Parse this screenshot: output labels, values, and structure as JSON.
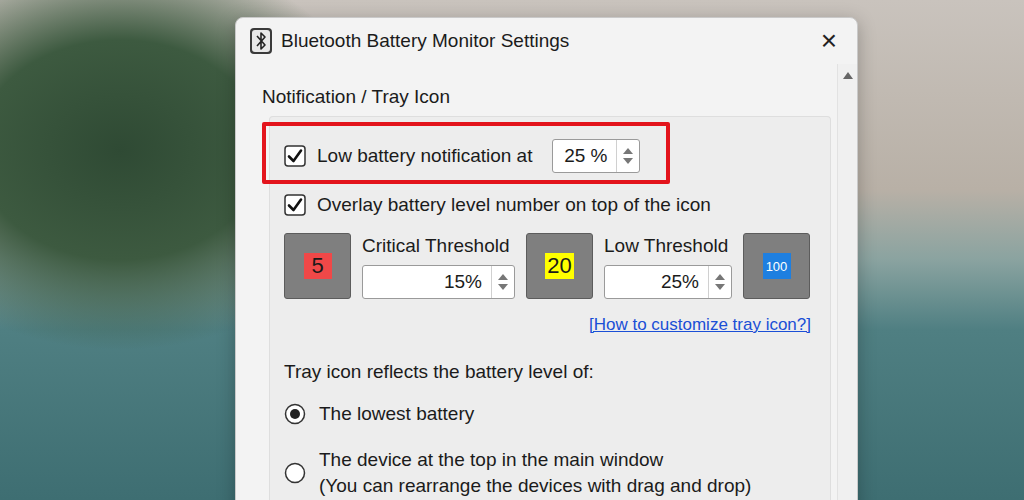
{
  "window": {
    "title": "Bluetooth Battery Monitor Settings",
    "close": "×"
  },
  "section": {
    "title": "Notification / Tray Icon"
  },
  "low_battery": {
    "label": "Low battery notification at",
    "checked": true,
    "value": "25 %"
  },
  "overlay": {
    "label": "Overlay battery level number on top of the icon",
    "checked": true
  },
  "thresholds": {
    "icons": [
      {
        "text": "5",
        "color": "#f04848"
      },
      {
        "text": "20",
        "color": "#ffff00"
      },
      {
        "text": "100",
        "color": "#1e7fe0"
      }
    ],
    "fields": [
      {
        "label": "Critical Threshold",
        "value": "15%"
      },
      {
        "label": "Low Threshold",
        "value": "25%"
      }
    ]
  },
  "link": "[How to customize tray icon?]",
  "tray": {
    "label": "Tray icon reflects the battery level of:",
    "options": [
      {
        "label": "The lowest battery",
        "note": "",
        "selected": true
      },
      {
        "label": "The device at the top in the main window",
        "note": "(You can rearrange the devices with drag and drop)",
        "selected": false
      }
    ]
  }
}
